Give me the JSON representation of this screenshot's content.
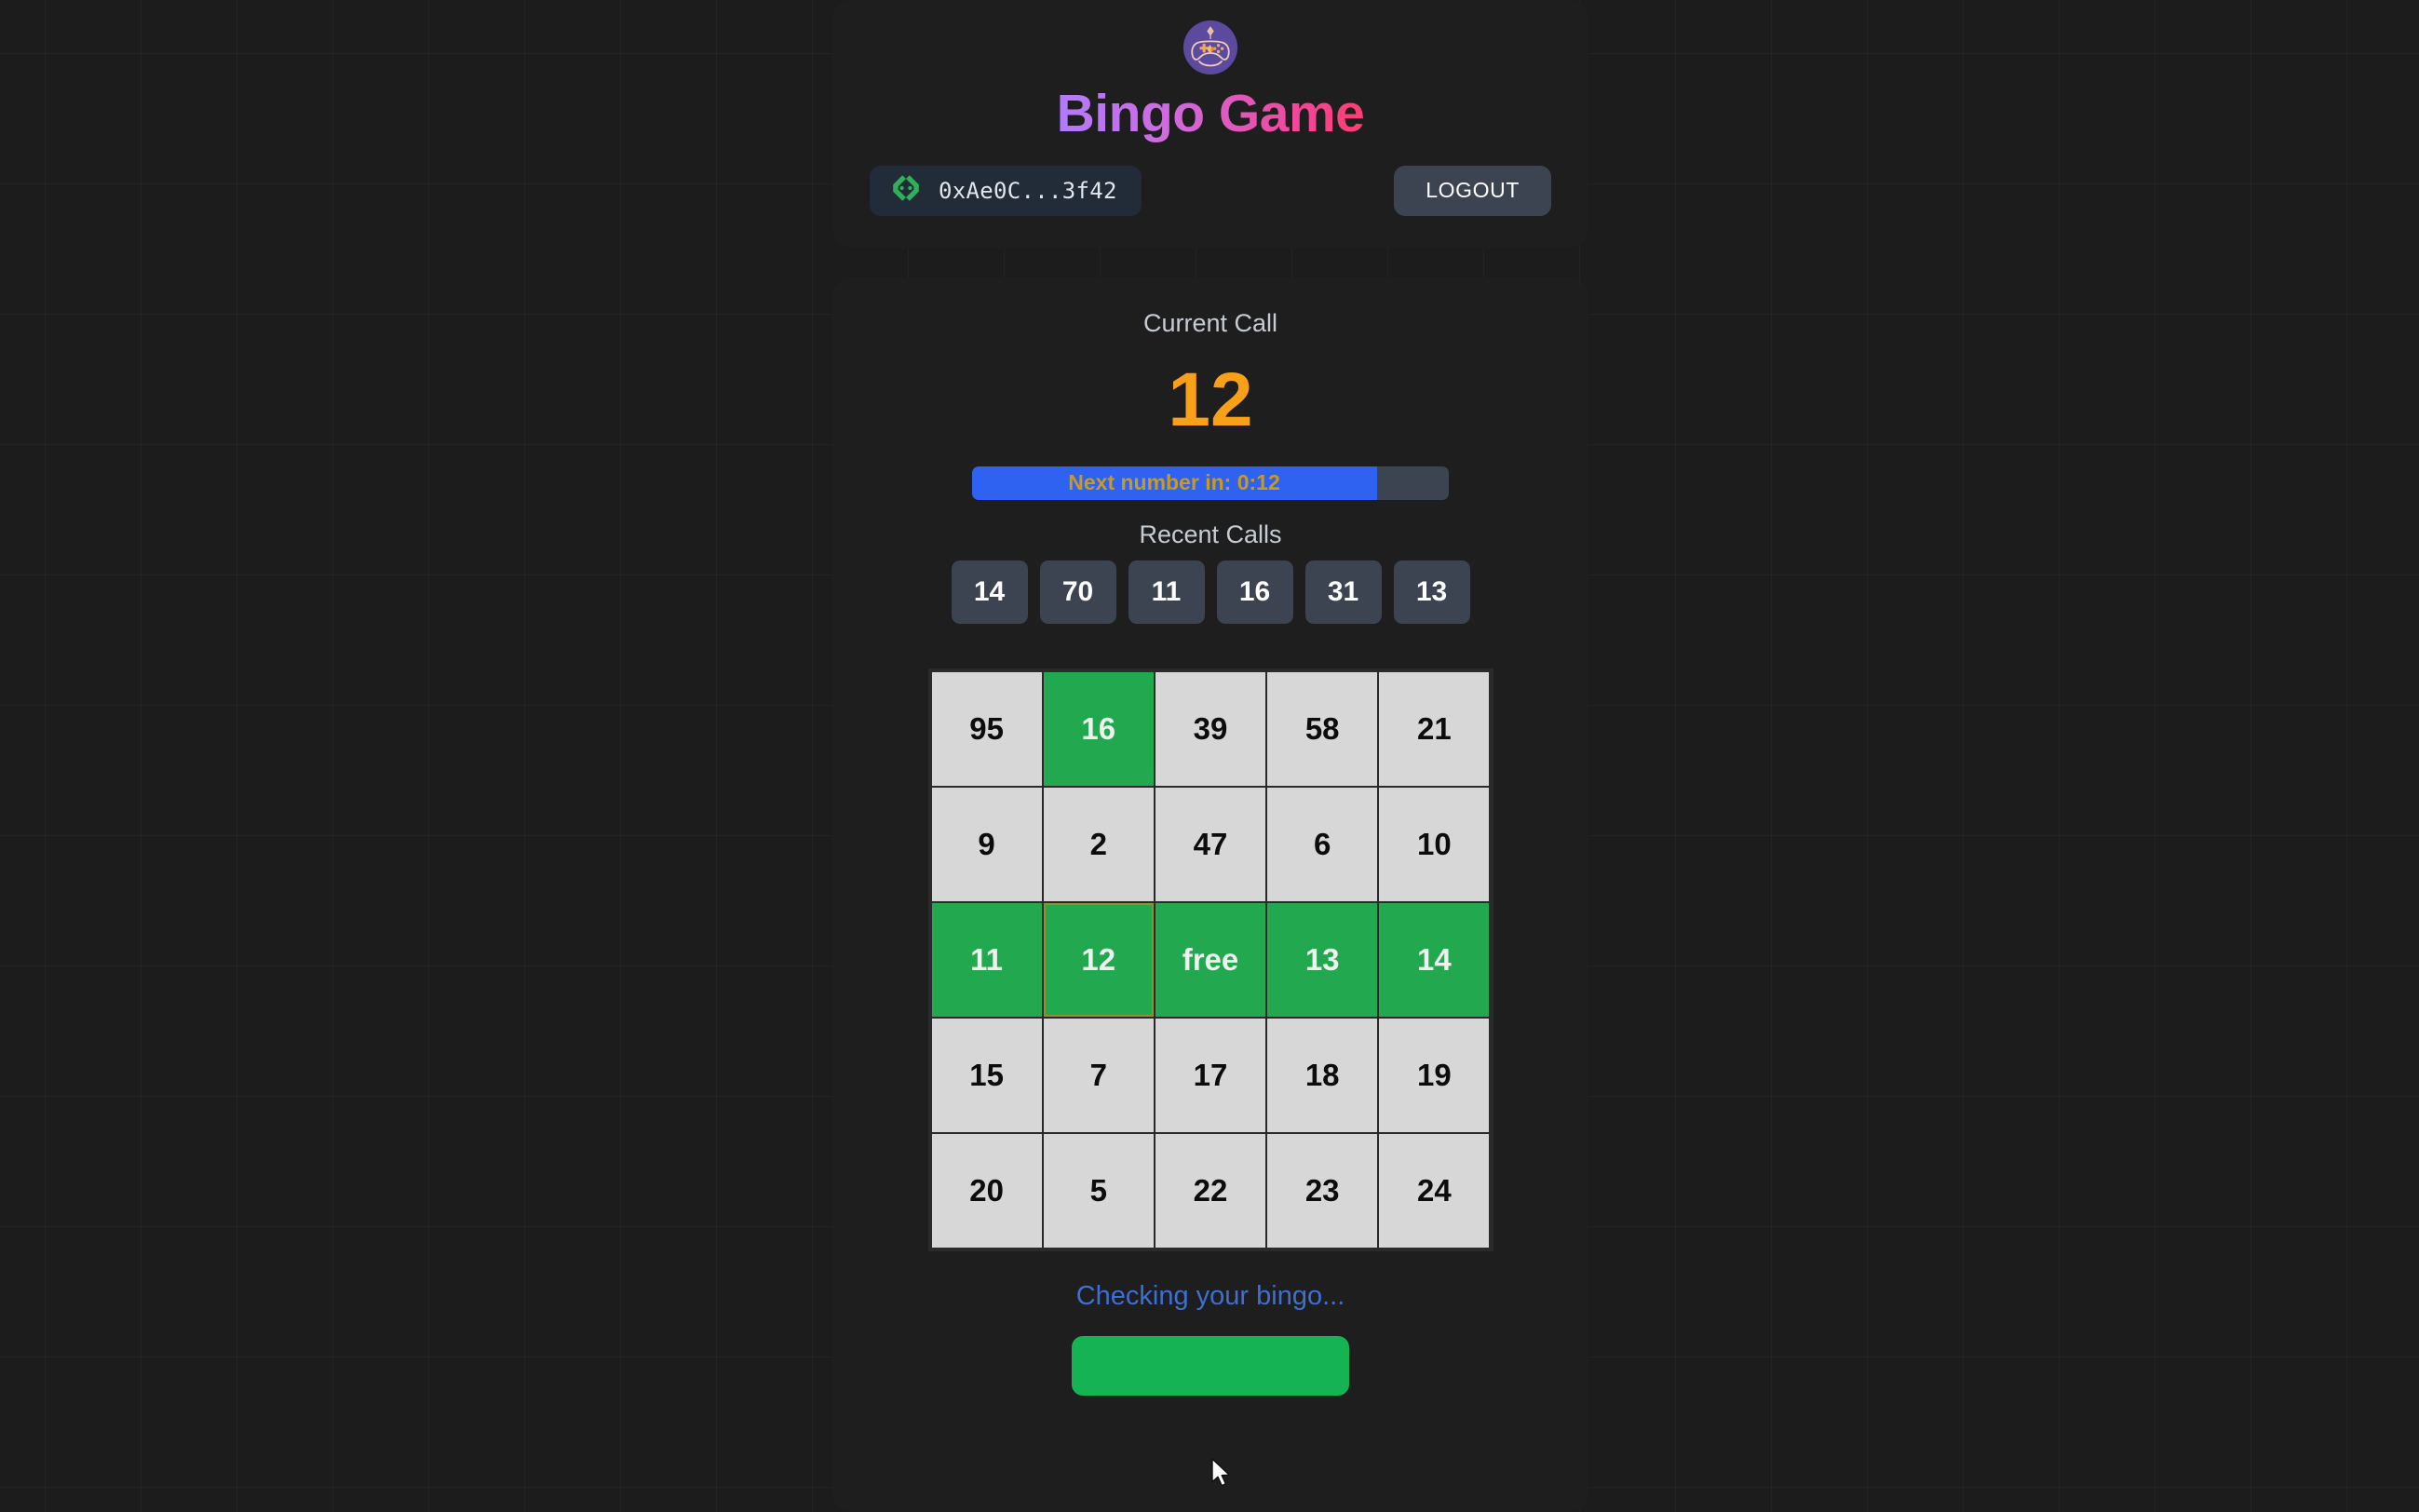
{
  "header": {
    "logo_icon": "gamepad-icon",
    "title": "Bingo Game",
    "wallet": {
      "icon": "wallet-icon",
      "address": "0xAe0C...3f42"
    },
    "logout_label": "LOGOUT"
  },
  "game": {
    "current_call_label": "Current Call",
    "current_call_number": "12",
    "timer": {
      "text": "Next number in: 0:12",
      "progress_percent": 85
    },
    "recent_calls_label": "Recent Calls",
    "recent_calls": [
      "14",
      "70",
      "11",
      "16",
      "31",
      "13"
    ],
    "card": {
      "rows": [
        [
          {
            "value": "95",
            "marked": false,
            "current": false
          },
          {
            "value": "16",
            "marked": true,
            "current": false
          },
          {
            "value": "39",
            "marked": false,
            "current": false
          },
          {
            "value": "58",
            "marked": false,
            "current": false
          },
          {
            "value": "21",
            "marked": false,
            "current": false
          }
        ],
        [
          {
            "value": "9",
            "marked": false,
            "current": false
          },
          {
            "value": "2",
            "marked": false,
            "current": false
          },
          {
            "value": "47",
            "marked": false,
            "current": false
          },
          {
            "value": "6",
            "marked": false,
            "current": false
          },
          {
            "value": "10",
            "marked": false,
            "current": false
          }
        ],
        [
          {
            "value": "11",
            "marked": true,
            "current": false
          },
          {
            "value": "12",
            "marked": true,
            "current": true
          },
          {
            "value": "free",
            "marked": true,
            "current": false
          },
          {
            "value": "13",
            "marked": true,
            "current": false
          },
          {
            "value": "14",
            "marked": true,
            "current": false
          }
        ],
        [
          {
            "value": "15",
            "marked": false,
            "current": false
          },
          {
            "value": "7",
            "marked": false,
            "current": false
          },
          {
            "value": "17",
            "marked": false,
            "current": false
          },
          {
            "value": "18",
            "marked": false,
            "current": false
          },
          {
            "value": "19",
            "marked": false,
            "current": false
          }
        ],
        [
          {
            "value": "20",
            "marked": false,
            "current": false
          },
          {
            "value": "5",
            "marked": false,
            "current": false
          },
          {
            "value": "22",
            "marked": false,
            "current": false
          },
          {
            "value": "23",
            "marked": false,
            "current": false
          },
          {
            "value": "24",
            "marked": false,
            "current": false
          }
        ]
      ]
    },
    "status_text": "Checking your bingo...",
    "claim_button_label": ""
  },
  "colors": {
    "accent_orange": "#f9a01b",
    "accent_green": "#22a84f",
    "accent_blue": "#2f62f0",
    "status_blue": "#3d6fd4",
    "claim_green": "#16b354",
    "wallet_green": "#2fb05a",
    "chip_slate": "#3c4451",
    "card_bg": "#1e1e1e",
    "page_bg": "#1c1c1c",
    "current_cell_border": "#94902b"
  }
}
